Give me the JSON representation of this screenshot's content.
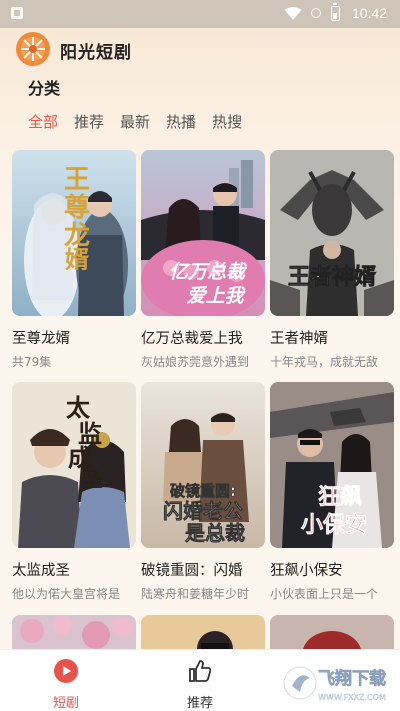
{
  "status_bar": {
    "time": "10:42"
  },
  "header": {
    "app_title": "阳光短剧"
  },
  "section_label": "分类",
  "category_tabs": [
    {
      "label": "全部",
      "active": true
    },
    {
      "label": "推荐",
      "active": false
    },
    {
      "label": "最新",
      "active": false
    },
    {
      "label": "热播",
      "active": false
    },
    {
      "label": "热搜",
      "active": false
    }
  ],
  "dramas": [
    {
      "title": "至尊龙婿",
      "subtitle": "共79集",
      "poster_text": "至尊龙婿"
    },
    {
      "title": "亿万总裁爱上我",
      "subtitle": "灰姑娘苏莞意外遇到",
      "poster_text": "亿万总裁爱上我"
    },
    {
      "title": "王者神婿",
      "subtitle": "十年戎马，成就无敌",
      "poster_text": "王者神婿"
    },
    {
      "title": "太监成圣",
      "subtitle": "他以为偌大皇宫将是",
      "poster_text": "太监成圣"
    },
    {
      "title": "破镜重圆：闪婚",
      "subtitle": "陆寒舟和姜糖年少时",
      "poster_text": "破镜重圆：闪婚老公是总裁"
    },
    {
      "title": "狂飙小保安",
      "subtitle": "小伙表面上只是一个",
      "poster_text": "狂飙小保安"
    }
  ],
  "bottom_nav": [
    {
      "label": "短剧",
      "icon": "play-circle-icon",
      "active": true
    },
    {
      "label": "推荐",
      "icon": "thumbs-up-icon",
      "active": false
    }
  ],
  "watermark": {
    "text": "飞翔下载",
    "url_text": "WWW.FXXZ.COM"
  },
  "colors": {
    "accent": "#e8544c",
    "background": "#fdf6ee"
  }
}
